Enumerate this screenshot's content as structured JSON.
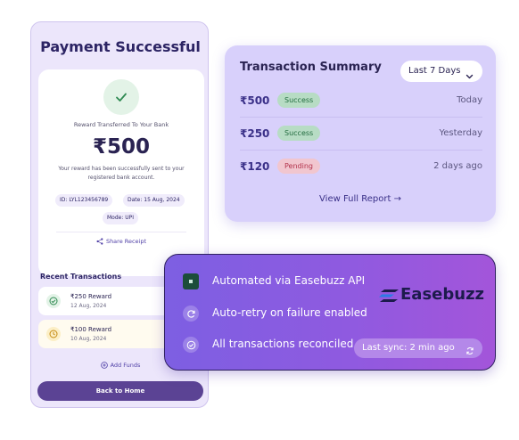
{
  "colors": {
    "brand_purple": "#5b4394",
    "success_green": "#226c3f",
    "pending_red": "#b2334c",
    "summary_bg": "#d8d0fb",
    "automation_gradient_start": "#7d5fe2",
    "automation_gradient_end": "#a355da"
  },
  "payment": {
    "title": "Payment Successful",
    "status_icon": "check-icon",
    "label": "Reward Transferred To Your Bank",
    "amount": "₹500",
    "message": "Your reward has been successfully sent to your registered bank account.",
    "id_chip": "ID: LYL123456789",
    "date_chip": "Date: 15 Aug, 2024",
    "mode_chip": "Mode: UPI",
    "share_label": "Share Receipt",
    "share_icon": "share-icon"
  },
  "recent": {
    "title": "Recent Transactions",
    "items": [
      {
        "name": "₹250 Reward",
        "date": "12 Aug, 2024",
        "icon": "check-circle-icon"
      },
      {
        "name": "₹100 Reward",
        "date": "10 Aug, 2024",
        "icon": "clock-icon"
      }
    ],
    "add_funds_label": "Add Funds",
    "add_funds_icon": "plus-circle-icon",
    "home_button_label": "Back to Home"
  },
  "summary": {
    "title": "Transaction Summary",
    "range_selected": "Last 7 Days",
    "range_icon": "chevron-down-icon",
    "rows": [
      {
        "amount": "₹500",
        "status": "Success",
        "when": "Today"
      },
      {
        "amount": "₹250",
        "status": "Success",
        "when": "Yesterday"
      },
      {
        "amount": "₹120",
        "status": "Pending",
        "when": "2 days ago"
      }
    ],
    "view_report_label": "View Full Report →"
  },
  "automation": {
    "features": [
      {
        "text": "Automated via Easebuzz API",
        "icon": "api-icon"
      },
      {
        "text": "Auto-retry on failure enabled",
        "icon": "retry-icon"
      },
      {
        "text": "All transactions reconciled",
        "icon": "check-circle-icon"
      }
    ],
    "brand_name": "Easebuzz",
    "sync_label": "Last sync: 2 min ago",
    "sync_icon": "refresh-icon"
  }
}
